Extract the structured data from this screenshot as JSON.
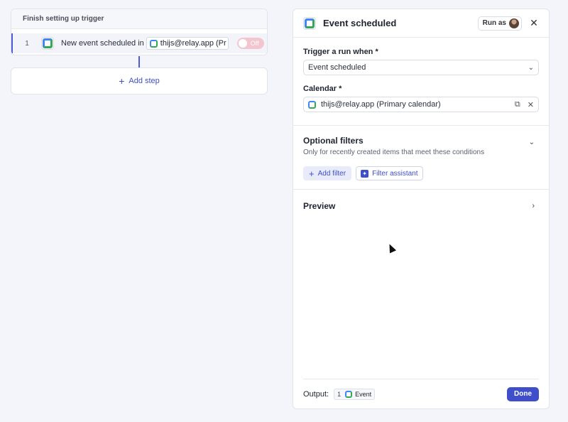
{
  "workflow": {
    "header": "Finish setting up trigger",
    "step": {
      "number": "1",
      "text": "New event scheduled in",
      "calendar_chip": "thijs@relay.app (Pr",
      "toggle": "Off"
    },
    "add_step": "Add step"
  },
  "panel": {
    "title": "Event scheduled",
    "run_as": "Run as",
    "trigger": {
      "label": "Trigger a run when *",
      "value": "Event scheduled"
    },
    "calendar": {
      "label": "Calendar *",
      "value": "thijs@relay.app (Primary calendar)"
    },
    "optional_filters": {
      "title": "Optional filters",
      "subtitle": "Only for recently created items that meet these conditions",
      "add_filter": "Add filter",
      "filter_assistant": "Filter assistant"
    },
    "preview": {
      "title": "Preview"
    },
    "footer": {
      "output_label": "Output:",
      "output_num": "1",
      "output_item": "Event",
      "done": "Done"
    }
  },
  "colors": {
    "accent": "#3e4fc9",
    "toggle_off": "#f3c6cf"
  }
}
